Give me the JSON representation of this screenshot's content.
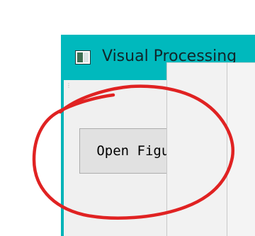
{
  "window": {
    "title": "Visual Processing",
    "icon": "app-window-icon",
    "title_bar_color": "#00b9bd"
  },
  "toolbar": {
    "grip_icon": "toolbar-grip-icon",
    "grip_glyph": "⋮"
  },
  "left_panel": {
    "open_figures_label": "Open Figures"
  },
  "annotation": {
    "shape": "hand-drawn-circle",
    "color": "#e02222"
  }
}
